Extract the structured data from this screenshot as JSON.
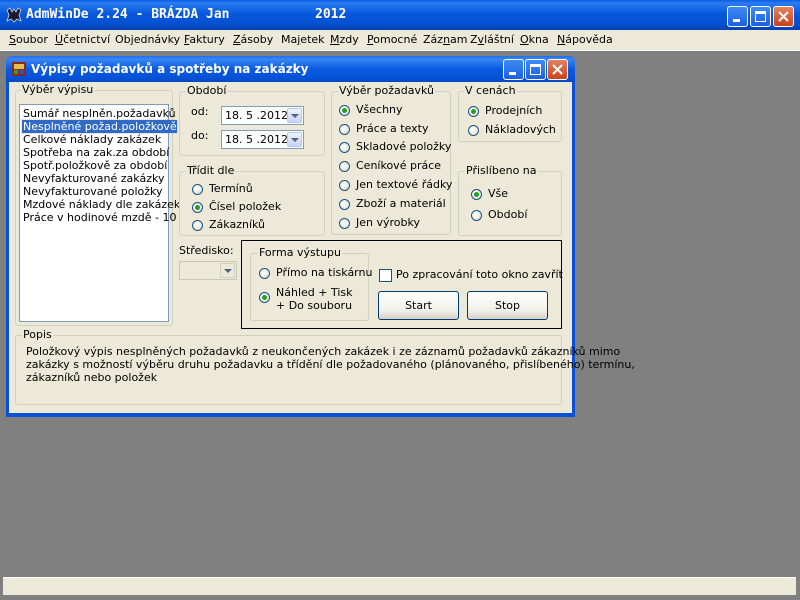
{
  "app": {
    "title": "AdmWinDe 2.24 - BRÁZDA Jan",
    "year": "2012"
  },
  "menu": [
    {
      "label": "Soubor",
      "key": "S"
    },
    {
      "label": "Účetnictví",
      "key": "Ú"
    },
    {
      "label": "Objednávky",
      "key": "j"
    },
    {
      "label": "Faktury",
      "key": "F"
    },
    {
      "label": "Zásoby",
      "key": "Z"
    },
    {
      "label": "Majetek",
      "key": "j"
    },
    {
      "label": "Mzdy",
      "key": "M"
    },
    {
      "label": "Pomocné",
      "key": "P"
    },
    {
      "label": "Záznam",
      "key": "n"
    },
    {
      "label": "Zvláštní",
      "key": "v"
    },
    {
      "label": "Okna",
      "key": "O"
    },
    {
      "label": "Nápověda",
      "key": "N"
    }
  ],
  "window": {
    "title": "Výpisy požadavků a spotřeby na zakázky"
  },
  "vyber_vypisu": {
    "label": "Výběr výpisu",
    "items": [
      "Sumář nesplněn.požadavků",
      "Nesplněné požad.položkově",
      "Celkové náklady zakázek",
      "Spotřeba na zak.za období",
      "Spotř.položkově za období",
      "Nevyfakturované zakázky",
      "Nevyfakturované položky",
      "Mzdové náklady dle zakázek",
      "Práce v hodinové mzdě - 10"
    ],
    "selected_index": 1
  },
  "obdobi": {
    "label": "Období",
    "od_label": "od:",
    "od_value": "18. 5 .2012",
    "do_label": "do:",
    "do_value": "18. 5 .2012"
  },
  "tridit": {
    "label": "Třídit dle",
    "options": [
      "Termínů",
      "Čísel položek",
      "Zákazníků"
    ],
    "selected_index": 1
  },
  "vyber_pozadavku": {
    "label": "Výběr požadavků",
    "options": [
      "Všechny",
      "Práce a texty",
      "Skladové položky",
      "Ceníkové práce",
      "Jen textové řádky",
      "Zboží a materiál",
      "Jen výrobky"
    ],
    "selected_index": 0
  },
  "v_cenach": {
    "label": "V cenách",
    "options": [
      "Prodejních",
      "Nákladových"
    ],
    "selected_index": 0
  },
  "prisl": {
    "label": "Přislíbeno na",
    "options": [
      "Vše",
      "Období"
    ],
    "selected_index": 0
  },
  "stredisko": {
    "label": "Středisko:",
    "value": ""
  },
  "forma": {
    "label": "Forma výstupu",
    "opt1": "Přímo na tiskárnu",
    "opt2_line1": "Náhled + Tisk",
    "opt2_line2": "+ Do souboru",
    "selected_index": 1,
    "close_checkbox_label": "Po zpracování toto okno zavřít",
    "close_checked": false,
    "start_label": "Start",
    "stop_label": "Stop"
  },
  "popis": {
    "label": "Popis",
    "line1": "Položkový výpis nesplněných požadavků z neukončených zakázek i ze záznamů požadavků zákazníků mimo",
    "line2": "zakázky s možností výběru druhu požadavku a třídění dle požadovaného (plánovaného, přislíbeného) termínu,",
    "line3": "zákazníků nebo položek"
  }
}
